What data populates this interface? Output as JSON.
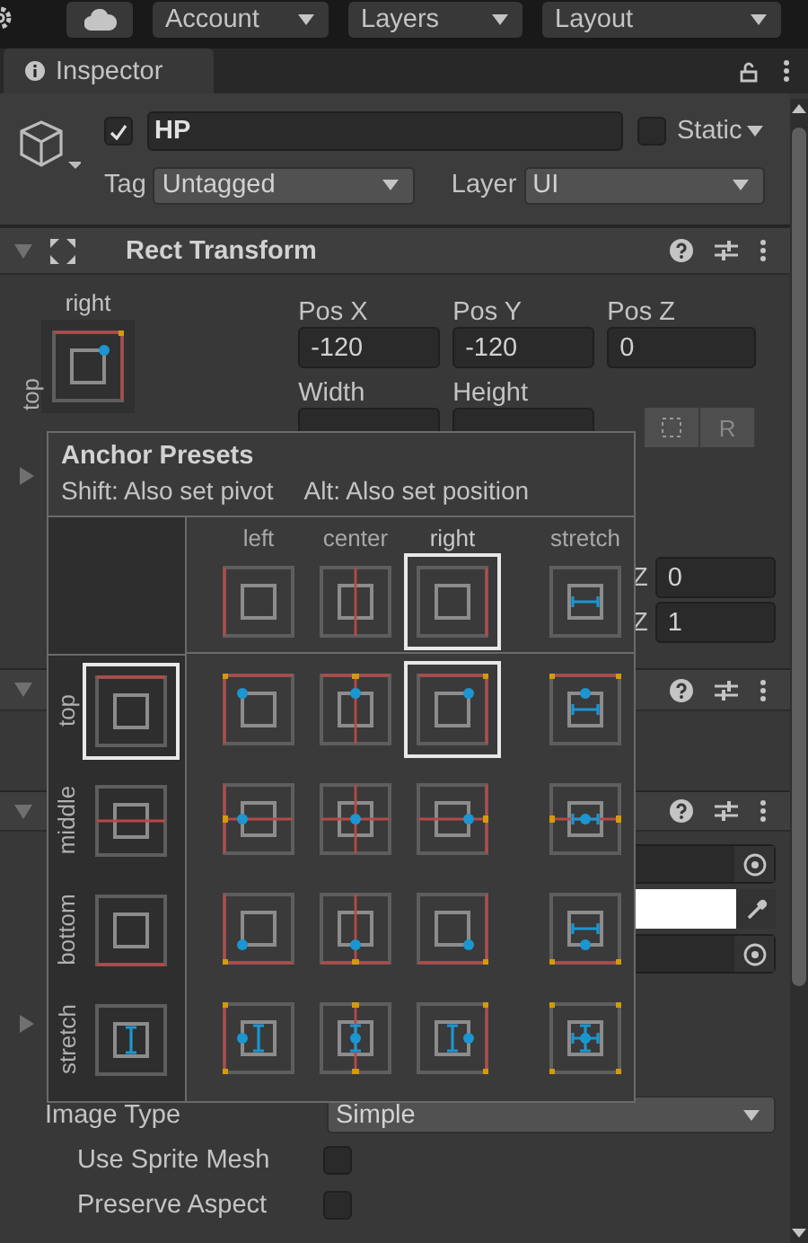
{
  "toolbar": {
    "dropdowns": [
      "Account",
      "Layers",
      "Layout"
    ]
  },
  "tab": {
    "label": "Inspector"
  },
  "object": {
    "active": true,
    "name": "HP",
    "static": false,
    "static_label": "Static",
    "tag_label": "Tag",
    "tag": "Untagged",
    "layer_label": "Layer",
    "layer": "UI"
  },
  "rect_transform": {
    "title": "Rect Transform",
    "expanded": true,
    "anchor_h": "right",
    "anchor_v": "top",
    "fields": [
      {
        "label": "Pos X",
        "value": "-120"
      },
      {
        "label": "Pos Y",
        "value": "-120"
      },
      {
        "label": "Pos Z",
        "value": "0"
      },
      {
        "label": "Width"
      },
      {
        "label": "Height"
      }
    ],
    "raw_button": "R",
    "anchors_expanded": false,
    "z_rows": [
      {
        "label": "Z",
        "value": "0"
      },
      {
        "label": "Z",
        "value": "1"
      }
    ]
  },
  "components": [
    {
      "expanded": true
    },
    {
      "expanded": true
    }
  ],
  "image": {
    "fields": [
      {
        "kind": "object"
      },
      {
        "kind": "color",
        "color": "#ffffff"
      },
      {
        "kind": "object"
      }
    ],
    "foldout_expanded": false,
    "image_type_label": "Image Type",
    "image_type": "Simple",
    "toggles": [
      {
        "label": "Use Sprite Mesh",
        "checked": false
      },
      {
        "label": "Preserve Aspect",
        "checked": false
      }
    ]
  },
  "popup": {
    "title": "Anchor Presets",
    "hints": [
      "Shift: Also set pivot",
      "Alt: Also set position"
    ],
    "columns": [
      {
        "label": "left",
        "selected": false
      },
      {
        "label": "center",
        "selected": false
      },
      {
        "label": "right",
        "selected": true
      },
      {
        "label": "stretch",
        "selected": false
      }
    ],
    "rows": [
      {
        "label": "top",
        "selected": true,
        "cells": [
          {
            "selected": false
          },
          {
            "selected": false
          },
          {
            "selected": true
          },
          {
            "selected": false
          }
        ]
      },
      {
        "label": "middle",
        "selected": false,
        "cells": [
          {
            "selected": false
          },
          {
            "selected": false
          },
          {
            "selected": false
          },
          {
            "selected": false
          }
        ]
      },
      {
        "label": "bottom",
        "selected": false,
        "cells": [
          {
            "selected": false
          },
          {
            "selected": false
          },
          {
            "selected": false
          },
          {
            "selected": false
          }
        ]
      },
      {
        "label": "stretch",
        "selected": false,
        "cells": [
          {
            "selected": false
          },
          {
            "selected": false
          },
          {
            "selected": false
          },
          {
            "selected": false
          }
        ]
      }
    ]
  }
}
